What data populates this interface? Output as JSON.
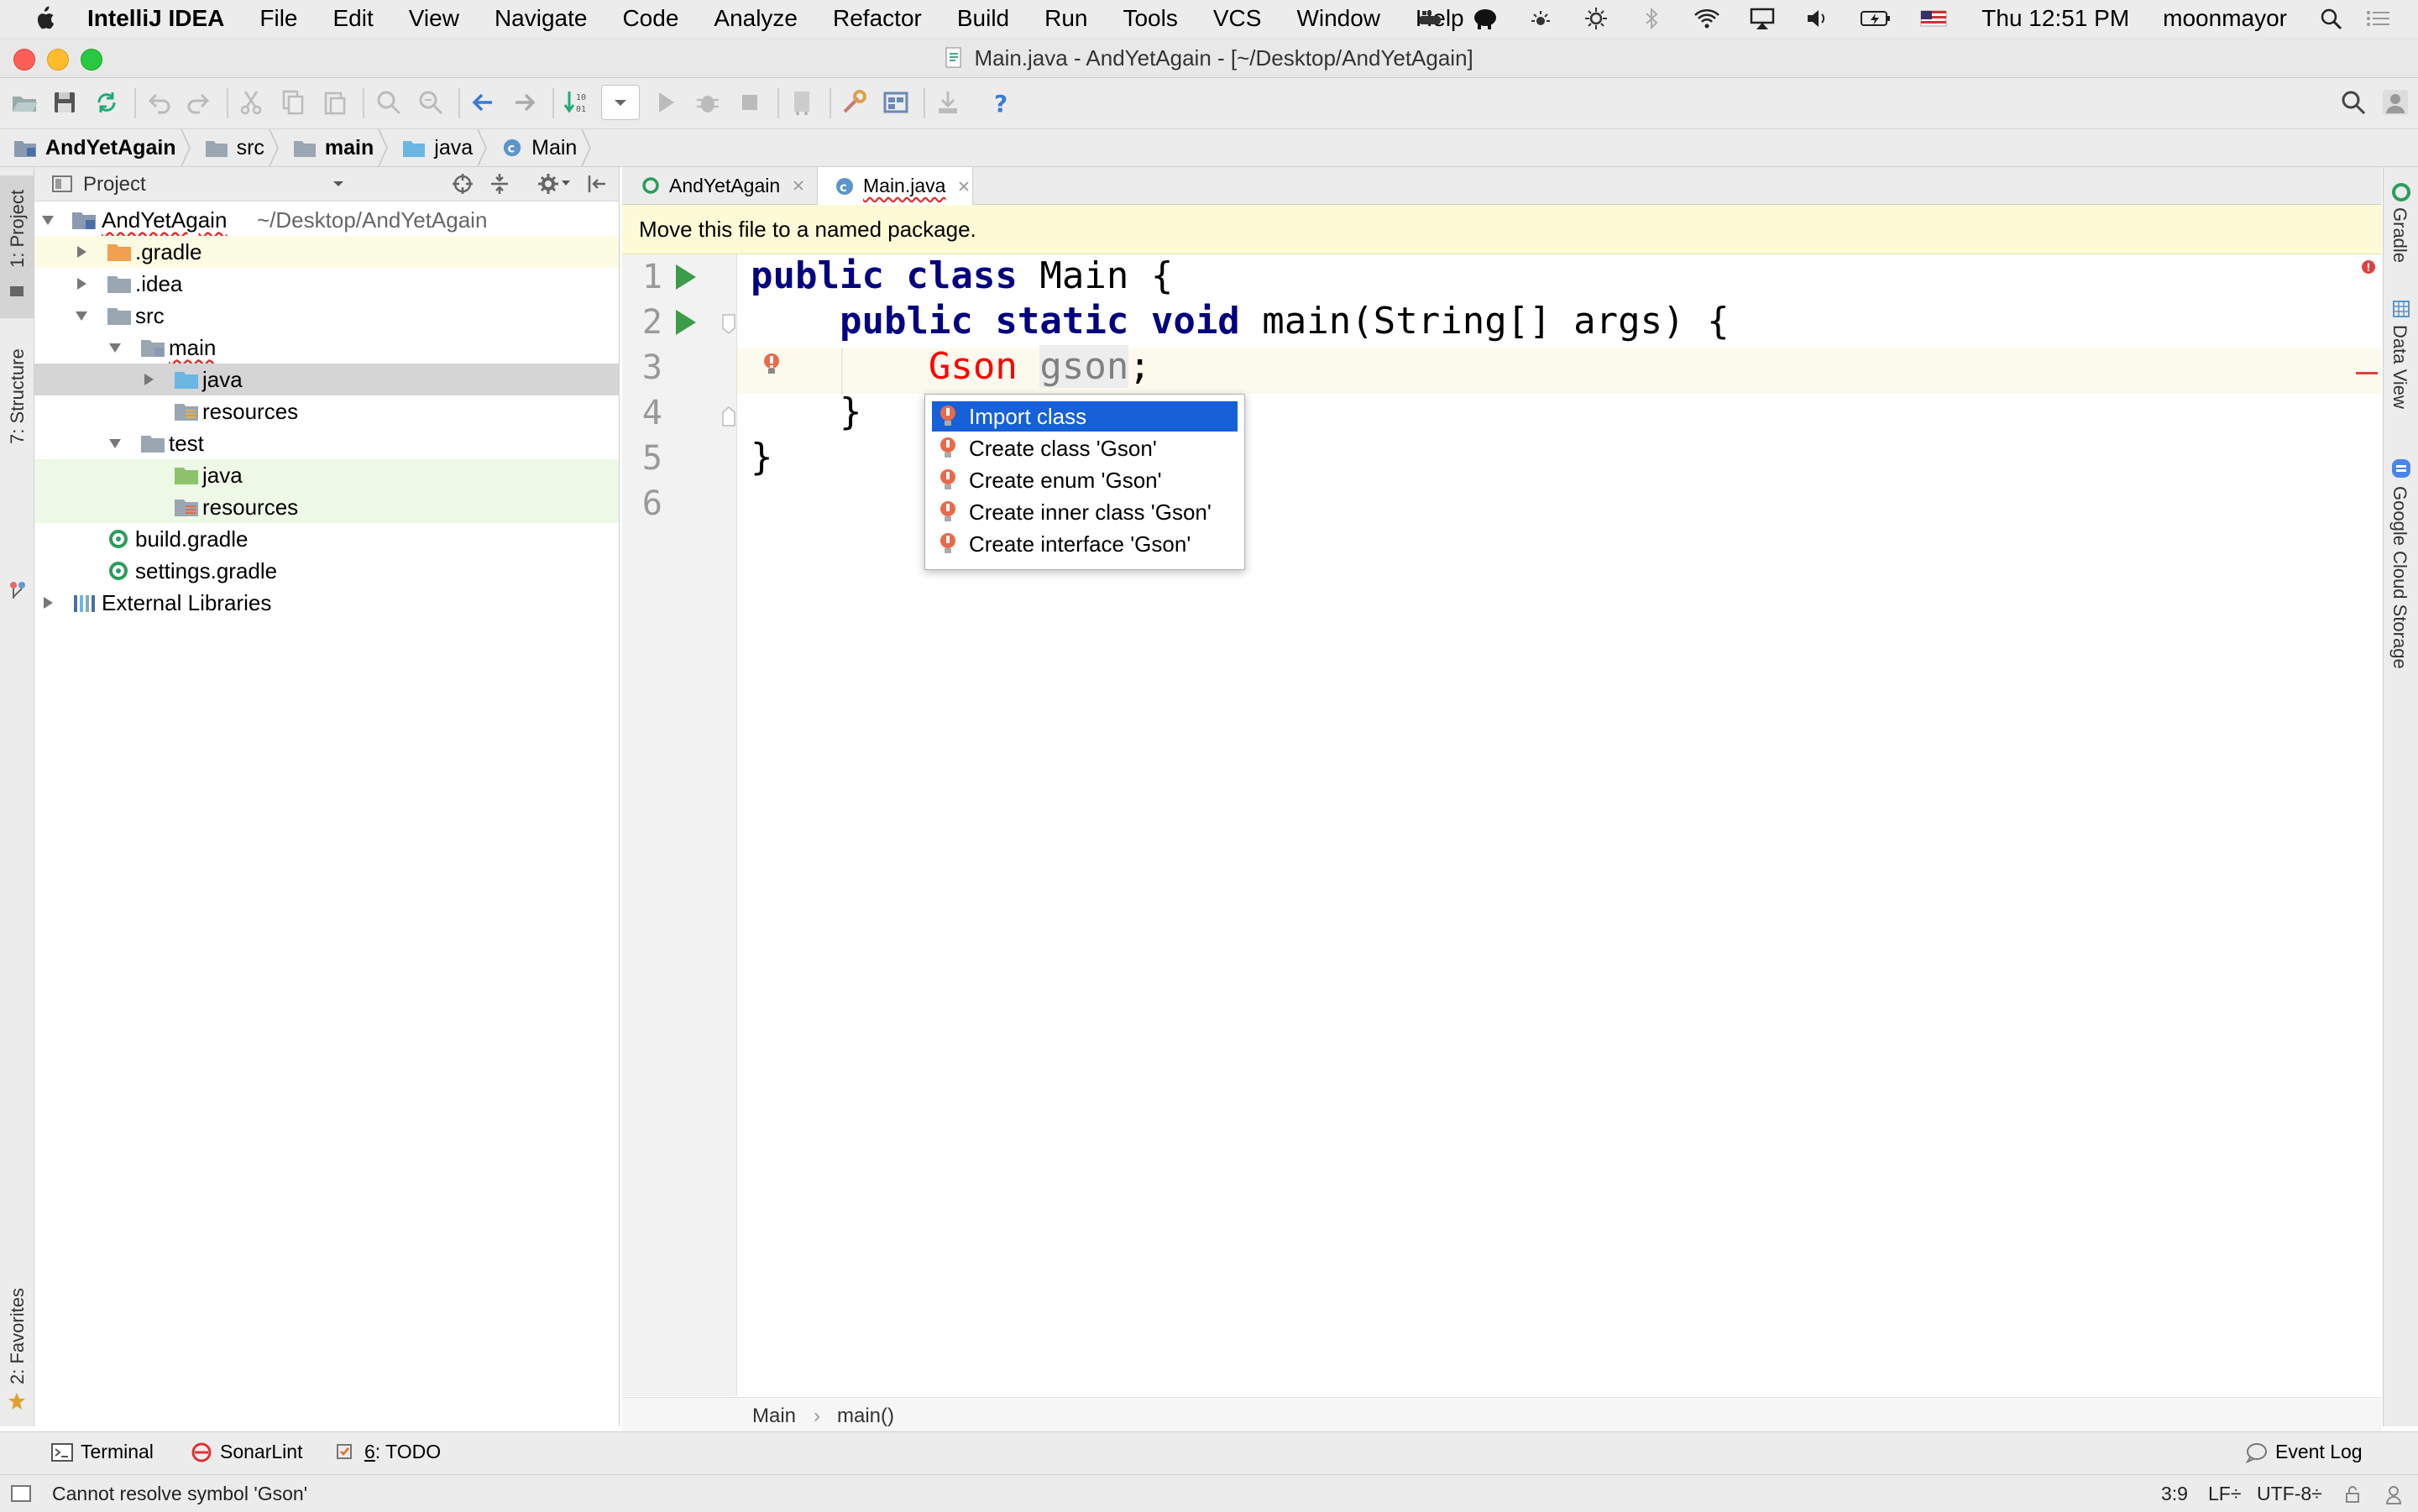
{
  "menubar": {
    "app_name": "IntelliJ IDEA",
    "items": [
      "File",
      "Edit",
      "View",
      "Navigate",
      "Code",
      "Analyze",
      "Refactor",
      "Build",
      "Run",
      "Tools",
      "VCS",
      "Window",
      "Help"
    ],
    "clock": "Thu 12:51 PM",
    "user": "moonmayor"
  },
  "window": {
    "title": "Main.java - AndYetAgain - [~/Desktop/AndYetAgain]"
  },
  "navbar": {
    "crumbs": [
      {
        "label": "AndYetAgain",
        "icon": "module-folder-icon"
      },
      {
        "label": "src",
        "icon": "folder-icon"
      },
      {
        "label": "main",
        "icon": "folder-icon"
      },
      {
        "label": "java",
        "icon": "source-folder-icon"
      },
      {
        "label": "Main",
        "icon": "class-icon"
      }
    ]
  },
  "left_strip": {
    "project_tab": "1: Project",
    "structure_tab": "7: Structure",
    "favorites_tab": "2: Favorites"
  },
  "right_strip": {
    "gradle_tab": "Gradle",
    "dataview_tab": "Data View",
    "gcs_tab": "Google Cloud Storage"
  },
  "project_panel": {
    "header": "Project",
    "tree": [
      {
        "label": "AndYetAgain",
        "extra": "~/Desktop/AndYetAgain",
        "depth": 0,
        "expanded": true
      },
      {
        "label": ".gradle",
        "depth": 1,
        "expanded": false
      },
      {
        "label": ".idea",
        "depth": 1,
        "expanded": false
      },
      {
        "label": "src",
        "depth": 1,
        "expanded": true
      },
      {
        "label": "main",
        "depth": 2,
        "expanded": true
      },
      {
        "label": "java",
        "depth": 3,
        "expanded": false,
        "selected": true
      },
      {
        "label": "resources",
        "depth": 3
      },
      {
        "label": "test",
        "depth": 2,
        "expanded": true
      },
      {
        "label": "java",
        "depth": 3
      },
      {
        "label": "resources",
        "depth": 3
      },
      {
        "label": "build.gradle",
        "depth": 1
      },
      {
        "label": "settings.gradle",
        "depth": 1
      },
      {
        "label": "External Libraries",
        "depth": 0,
        "expanded": false
      }
    ]
  },
  "editor": {
    "tabs": [
      {
        "label": "AndYetAgain",
        "active": false
      },
      {
        "label": "Main.java",
        "active": true
      }
    ],
    "banner": "Move this file to a named package.",
    "line_numbers": [
      "1",
      "2",
      "3",
      "4",
      "5",
      "6"
    ],
    "code": {
      "l1_kw": "public class",
      "l1_rest": " Main {",
      "l2_kw": "public static void",
      "l2_rest": " main(String[] args) {",
      "l3_type": "Gson",
      "l3_var": "gson",
      "l3_end": ";",
      "l4": "}",
      "l5": "}"
    },
    "popup": {
      "items": [
        "Import class",
        "Create class 'Gson'",
        "Create enum 'Gson'",
        "Create inner class 'Gson'",
        "Create interface 'Gson'"
      ],
      "selected_index": 0
    },
    "breadcrumb": {
      "class": "Main",
      "method": "main()"
    }
  },
  "bottom_tools": {
    "terminal": "Terminal",
    "sonarlint": "SonarLint",
    "todo_mnemonic": "6",
    "todo_label": ": TODO",
    "event_log": "Event Log"
  },
  "status": {
    "message": "Cannot resolve symbol 'Gson'",
    "position": "3:9",
    "line_sep": "LF÷",
    "encoding": "UTF-8÷"
  },
  "colors": {
    "accent_selection": "#1660d8",
    "error": "#ff0000",
    "keyword": "#000080",
    "banner_bg": "#fdfbd6"
  }
}
